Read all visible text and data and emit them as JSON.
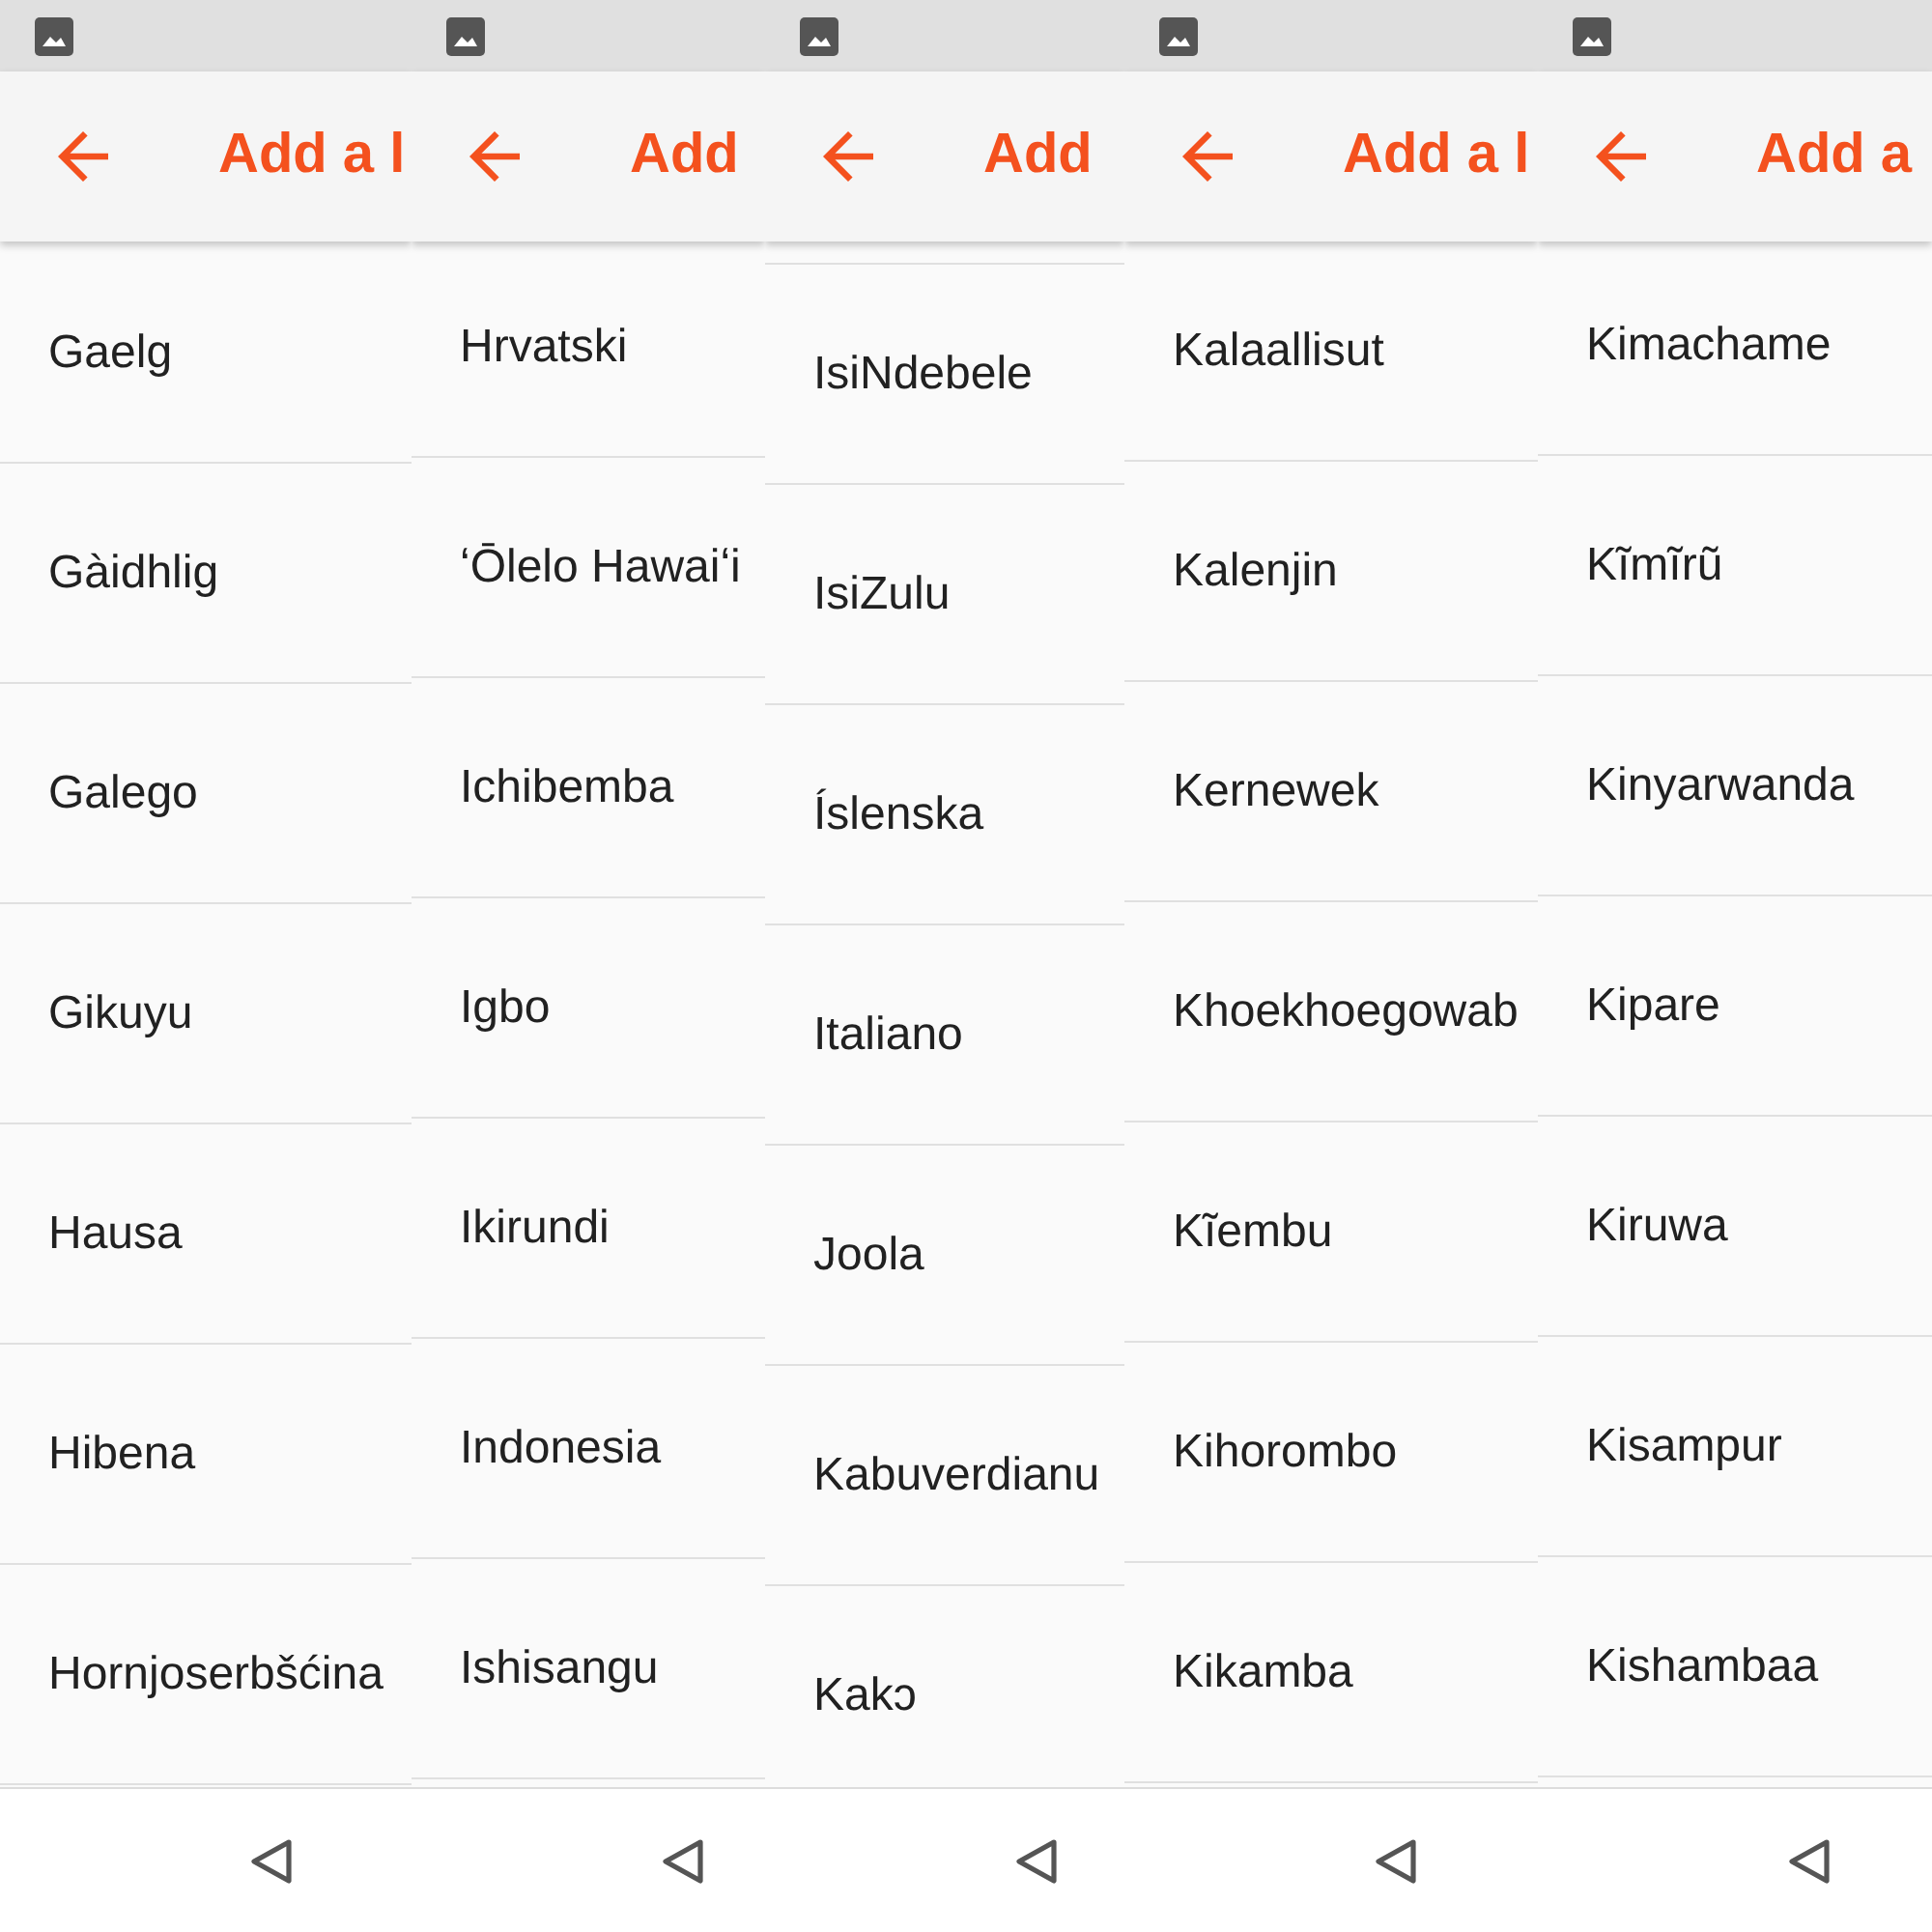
{
  "screens": [
    {
      "title": "Add a l",
      "languages": [
        "Gaelg",
        "Gàidhlig",
        "Galego",
        "Gikuyu",
        "Hausa",
        "Hibena",
        "Hornjoserbšćina"
      ]
    },
    {
      "title": "Add",
      "languages": [
        "Hrvatski",
        "ʻŌlelo Hawaiʻi",
        "Ichibemba",
        "Igbo",
        "Ikirundi",
        "Indonesia",
        "Ishisangu"
      ]
    },
    {
      "title": "Add",
      "languages": [
        "IsiNdebele",
        "IsiZulu",
        "Íslenska",
        "Italiano",
        "Joola",
        "Kabuverdianu",
        "Kakɔ"
      ]
    },
    {
      "title": "Add a l",
      "languages": [
        "Kalaallisut",
        "Kalenjin",
        "Kernewek",
        "Khoekhoegowab",
        "Kĩembu",
        "Kihorombo",
        "Kikamba"
      ]
    },
    {
      "title": "Add a",
      "languages": [
        "Kimachame",
        "Kĩmĩrũ",
        "Kinyarwanda",
        "Kipare",
        "Kiruwa",
        "Kisampur",
        "Kishambaa"
      ]
    }
  ]
}
